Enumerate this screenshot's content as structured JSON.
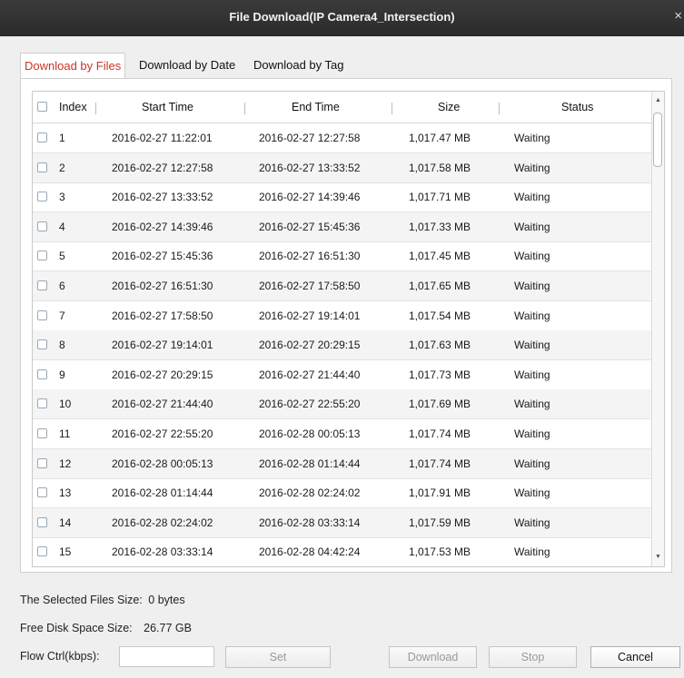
{
  "window": {
    "title": "File Download(IP Camera4_Intersection)",
    "close_glyph": "×"
  },
  "tabs": [
    {
      "label": "Download by Files",
      "active": true
    },
    {
      "label": "Download by Date",
      "active": false
    },
    {
      "label": "Download by Tag",
      "active": false
    }
  ],
  "table": {
    "columns": [
      "Index",
      "Start Time",
      "End Time",
      "Size",
      "Status"
    ],
    "rows": [
      {
        "index": "1",
        "start": "2016-02-27 11:22:01",
        "end": "2016-02-27 12:27:58",
        "size": "1,017.47 MB",
        "status": "Waiting"
      },
      {
        "index": "2",
        "start": "2016-02-27 12:27:58",
        "end": "2016-02-27 13:33:52",
        "size": "1,017.58 MB",
        "status": "Waiting"
      },
      {
        "index": "3",
        "start": "2016-02-27 13:33:52",
        "end": "2016-02-27 14:39:46",
        "size": "1,017.71 MB",
        "status": "Waiting"
      },
      {
        "index": "4",
        "start": "2016-02-27 14:39:46",
        "end": "2016-02-27 15:45:36",
        "size": "1,017.33 MB",
        "status": "Waiting"
      },
      {
        "index": "5",
        "start": "2016-02-27 15:45:36",
        "end": "2016-02-27 16:51:30",
        "size": "1,017.45 MB",
        "status": "Waiting"
      },
      {
        "index": "6",
        "start": "2016-02-27 16:51:30",
        "end": "2016-02-27 17:58:50",
        "size": "1,017.65 MB",
        "status": "Waiting"
      },
      {
        "index": "7",
        "start": "2016-02-27 17:58:50",
        "end": "2016-02-27 19:14:01",
        "size": "1,017.54 MB",
        "status": "Waiting"
      },
      {
        "index": "8",
        "start": "2016-02-27 19:14:01",
        "end": "2016-02-27 20:29:15",
        "size": "1,017.63 MB",
        "status": "Waiting"
      },
      {
        "index": "9",
        "start": "2016-02-27 20:29:15",
        "end": "2016-02-27 21:44:40",
        "size": "1,017.73 MB",
        "status": "Waiting"
      },
      {
        "index": "10",
        "start": "2016-02-27 21:44:40",
        "end": "2016-02-27 22:55:20",
        "size": "1,017.69 MB",
        "status": "Waiting"
      },
      {
        "index": "11",
        "start": "2016-02-27 22:55:20",
        "end": "2016-02-28 00:05:13",
        "size": "1,017.74 MB",
        "status": "Waiting"
      },
      {
        "index": "12",
        "start": "2016-02-28 00:05:13",
        "end": "2016-02-28 01:14:44",
        "size": "1,017.74 MB",
        "status": "Waiting"
      },
      {
        "index": "13",
        "start": "2016-02-28 01:14:44",
        "end": "2016-02-28 02:24:02",
        "size": "1,017.91 MB",
        "status": "Waiting"
      },
      {
        "index": "14",
        "start": "2016-02-28 02:24:02",
        "end": "2016-02-28 03:33:14",
        "size": "1,017.59 MB",
        "status": "Waiting"
      },
      {
        "index": "15",
        "start": "2016-02-28 03:33:14",
        "end": "2016-02-28 04:42:24",
        "size": "1,017.53 MB",
        "status": "Waiting"
      }
    ]
  },
  "footer": {
    "selected_size_label": "The Selected Files Size:",
    "selected_size_value": "0 bytes",
    "free_space_label": "Free Disk Space Size:",
    "free_space_value": "26.77 GB",
    "flow_ctrl_label": "Flow Ctrl(kbps):",
    "flow_ctrl_value": "",
    "set_label": "Set",
    "download_label": "Download",
    "stop_label": "Stop",
    "cancel_label": "Cancel"
  },
  "colors": {
    "active_tab": "#c8342a",
    "titlebar": "#333333"
  }
}
